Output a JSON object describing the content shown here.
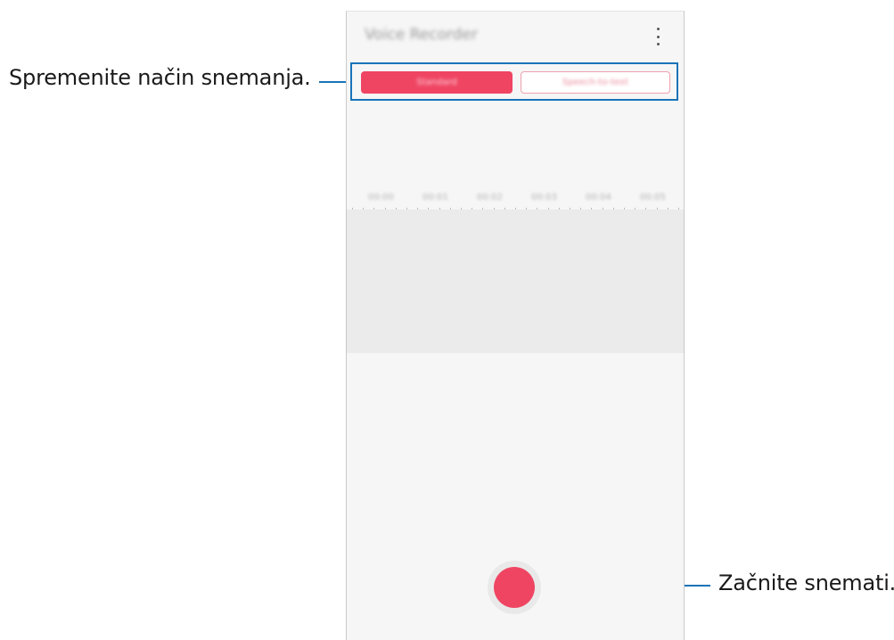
{
  "callouts": {
    "change_mode": "Spremenite način snemanja.",
    "start_recording": "Začnite snemati."
  },
  "app": {
    "title": "Voice Recorder",
    "menu_icon": "more-vertical-icon"
  },
  "modes": {
    "active_label": "Standard",
    "inactive_label": "Speech-to-text"
  },
  "timeline": {
    "labels": [
      "00:00",
      "00:01",
      "00:02",
      "00:03",
      "00:04",
      "00:05"
    ]
  },
  "controls": {
    "record_icon": "record-button"
  },
  "colors": {
    "accent": "#ef4563",
    "callout_line": "#1a73b8"
  }
}
